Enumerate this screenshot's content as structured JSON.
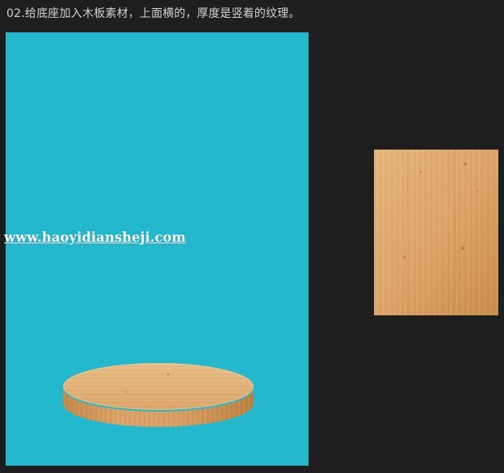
{
  "header": {
    "title": "02.给底座加入木板素材，上面横的，厚度是竖着的纹理。"
  },
  "canvas": {
    "background_color": "#24b8cf"
  },
  "watermark": {
    "text": "www.haoyidiansheji.com"
  },
  "colors": {
    "page_background": "#1e1e1e",
    "wood_light": "#e4b479",
    "wood_mid": "#d59a57",
    "wood_dark": "#b87a3c"
  },
  "icons": {
    "podium": "wooden-podium-icon",
    "swatch": "wood-texture-icon"
  }
}
